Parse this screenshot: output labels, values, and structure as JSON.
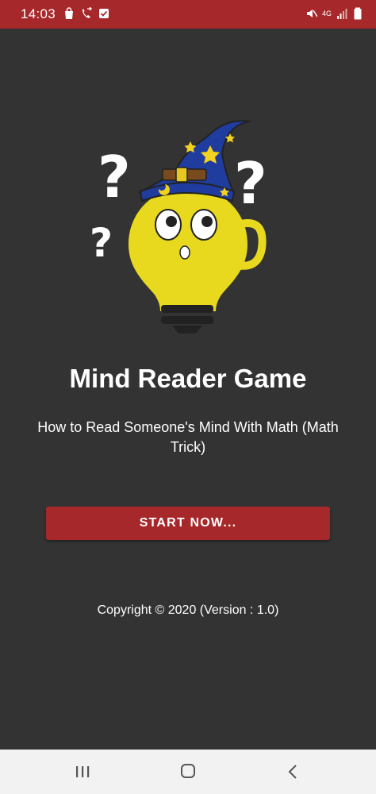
{
  "status_bar": {
    "time": "14:03",
    "network_label": "4G",
    "left_icons": [
      "shopping-bag-icon",
      "call-forward-icon",
      "checkbox-icon"
    ],
    "right_icons": [
      "mute-icon",
      "signal-icon",
      "battery-icon"
    ]
  },
  "main": {
    "title": "Mind Reader Game",
    "subtitle": "How to Read Someone's Mind With Math (Math Trick)",
    "start_button_label": "START NOW...",
    "copyright": "Copyright © 2020 (Version : 1.0)"
  },
  "nav": {
    "buttons": [
      "recent-apps",
      "home",
      "back"
    ]
  },
  "colors": {
    "background": "#333333",
    "accent": "#a6282a",
    "bulb": "#e8d91f",
    "hat": "#1f3c9e",
    "nav_bar": "#f2f2f2"
  }
}
